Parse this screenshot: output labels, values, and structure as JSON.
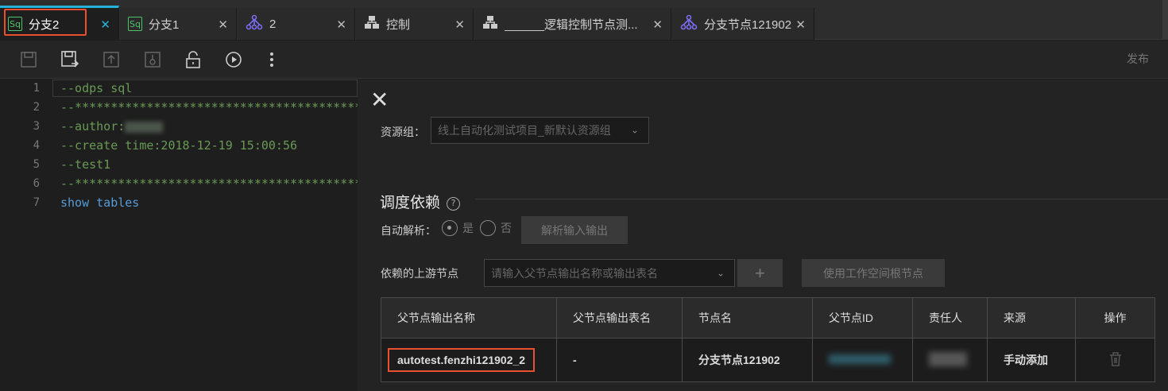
{
  "tabs": [
    {
      "label": "分支2",
      "icon": "sql-icon",
      "active": true
    },
    {
      "label": "分支1",
      "icon": "sql-icon"
    },
    {
      "label": "2",
      "icon": "branch-icon"
    },
    {
      "label": "控制",
      "icon": "control-icon"
    },
    {
      "label": "______逻辑控制节点测...",
      "icon": "control-icon"
    },
    {
      "label": "分支节点121902",
      "icon": "branch-icon"
    }
  ],
  "toolbar": {
    "icons": [
      "save-icon",
      "save-as-icon",
      "submit-icon",
      "unlock-upload-icon",
      "lock-icon",
      "run-icon",
      "more-icon"
    ],
    "publish_label": "发布"
  },
  "editor": {
    "line_numbers": [
      "1",
      "2",
      "3",
      "4",
      "5",
      "6",
      "7"
    ],
    "lines": [
      "--odps sql",
      "--**********************************************",
      "--author:",
      "--create time:2018-12-19 15:00:56",
      "--test1",
      "--**********************************************",
      "show tables"
    ]
  },
  "panel": {
    "close_icon": "close-icon",
    "resource_group_label": "资源组：",
    "resource_group_value": "线上自动化测试项目_新默认资源组",
    "section_title": "调度依赖",
    "help_glyph": "?",
    "auto_parse_label": "自动解析：",
    "radio_yes": "是",
    "radio_no": "否",
    "parse_button": "解析输入输出",
    "upstream_label": "依赖的上游节点",
    "upstream_placeholder": "请输入父节点输出名称或输出表名",
    "add_button": "+",
    "root_button": "使用工作空间根节点"
  },
  "table": {
    "headers": [
      "父节点输出名称",
      "父节点输出表名",
      "节点名",
      "父节点ID",
      "责任人",
      "来源",
      "操作"
    ],
    "rows": [
      {
        "output_name": "autotest.fenzhi121902_2",
        "output_table": "-",
        "node_name": "分支节点121902",
        "node_id": "",
        "owner": "",
        "source": "手动添加",
        "action_icon": "delete-icon"
      }
    ]
  },
  "colors": {
    "accent": "#25b4d8",
    "highlight_box": "#e8502f",
    "code_green": "#6a9955",
    "code_blue": "#569cd6",
    "sql_icon_green": "#4cc46a",
    "branch_icon_purple": "#7b6cf0"
  }
}
